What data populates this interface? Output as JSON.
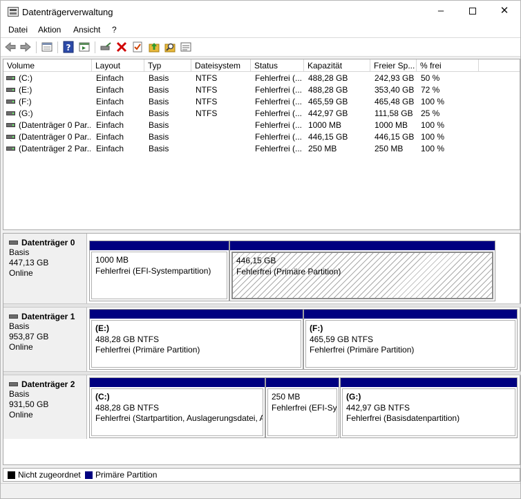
{
  "window": {
    "title": "Datenträgerverwaltung"
  },
  "menu": [
    "Datei",
    "Aktion",
    "Ansicht",
    "?"
  ],
  "toolbar": {
    "icons": [
      "back-icon",
      "forward-icon",
      "disk-list-icon",
      "help-icon",
      "properties-icon",
      "connect-icon",
      "delete-icon",
      "checklist-icon",
      "up-folder-icon",
      "search-folder-icon",
      "details-icon"
    ],
    "colors": {
      "delete": "#d00000",
      "help": "#2c4aa8",
      "folder": "#e8b83c"
    }
  },
  "volume_list": {
    "columns": [
      "Volume",
      "Layout",
      "Typ",
      "Dateisystem",
      "Status",
      "Kapazität",
      "Freier Sp...",
      "% frei"
    ],
    "rows": [
      {
        "volume": "(C:)",
        "layout": "Einfach",
        "typ": "Basis",
        "dateisystem": "NTFS",
        "status": "Fehlerfrei (...",
        "kapazitaet": "488,28 GB",
        "frei": "242,93 GB",
        "prozent": "50 %"
      },
      {
        "volume": "(E:)",
        "layout": "Einfach",
        "typ": "Basis",
        "dateisystem": "NTFS",
        "status": "Fehlerfrei (...",
        "kapazitaet": "488,28 GB",
        "frei": "353,40 GB",
        "prozent": "72 %"
      },
      {
        "volume": "(F:)",
        "layout": "Einfach",
        "typ": "Basis",
        "dateisystem": "NTFS",
        "status": "Fehlerfrei (...",
        "kapazitaet": "465,59 GB",
        "frei": "465,48 GB",
        "prozent": "100 %"
      },
      {
        "volume": "(G:)",
        "layout": "Einfach",
        "typ": "Basis",
        "dateisystem": "NTFS",
        "status": "Fehlerfrei (...",
        "kapazitaet": "442,97 GB",
        "frei": "111,58 GB",
        "prozent": "25 %"
      },
      {
        "volume": "(Datenträger 0 Par...",
        "layout": "Einfach",
        "typ": "Basis",
        "dateisystem": "",
        "status": "Fehlerfrei (...",
        "kapazitaet": "1000 MB",
        "frei": "1000 MB",
        "prozent": "100 %"
      },
      {
        "volume": "(Datenträger 0 Par...",
        "layout": "Einfach",
        "typ": "Basis",
        "dateisystem": "",
        "status": "Fehlerfrei (...",
        "kapazitaet": "446,15 GB",
        "frei": "446,15 GB",
        "prozent": "100 %"
      },
      {
        "volume": "(Datenträger 2 Par...",
        "layout": "Einfach",
        "typ": "Basis",
        "dateisystem": "",
        "status": "Fehlerfrei (...",
        "kapazitaet": "250 MB",
        "frei": "250 MB",
        "prozent": "100 %"
      }
    ]
  },
  "disks": [
    {
      "name": "Datenträger 0",
      "type": "Basis",
      "size": "447,13 GB",
      "state": "Online",
      "partitions": [
        {
          "title": "",
          "line1": "1000 MB",
          "line2": "Fehlerfrei (EFI-Systempartition)",
          "selected": false
        },
        {
          "title": "",
          "line1": "446,15 GB",
          "line2": "Fehlerfrei (Primäre Partition)",
          "selected": true
        }
      ]
    },
    {
      "name": "Datenträger 1",
      "type": "Basis",
      "size": "953,87 GB",
      "state": "Online",
      "partitions": [
        {
          "title": "(E:)",
          "line1": "488,28 GB NTFS",
          "line2": "Fehlerfrei (Primäre Partition)",
          "selected": false
        },
        {
          "title": "(F:)",
          "line1": "465,59 GB NTFS",
          "line2": "Fehlerfrei (Primäre Partition)",
          "selected": false
        }
      ]
    },
    {
      "name": "Datenträger 2",
      "type": "Basis",
      "size": "931,50 GB",
      "state": "Online",
      "partitions": [
        {
          "title": "(C:)",
          "line1": "488,28 GB NTFS",
          "line2": "Fehlerfrei (Startpartition, Auslagerungsdatei, A",
          "selected": false
        },
        {
          "title": "",
          "line1": "250 MB",
          "line2": "Fehlerfrei (EFI-Sys",
          "selected": false
        },
        {
          "title": "(G:)",
          "line1": "442,97 GB NTFS",
          "line2": "Fehlerfrei (Basisdatenpartition)",
          "selected": false
        }
      ]
    }
  ],
  "legend": [
    {
      "label": "Nicht zugeordnet",
      "color": "#000000"
    },
    {
      "label": "Primäre Partition",
      "color": "#000080"
    }
  ]
}
